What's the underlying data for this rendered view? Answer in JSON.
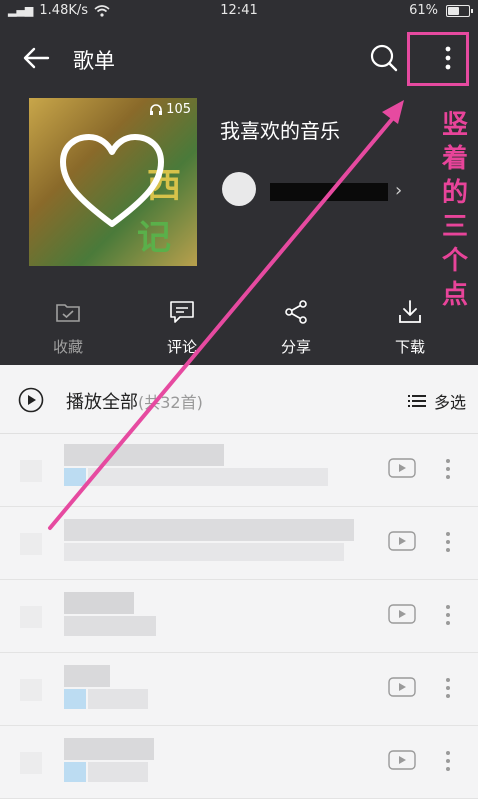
{
  "status_bar": {
    "net_speed": "1.48K/s",
    "time": "12:41",
    "battery": "61%",
    "battery_level": 0.61
  },
  "topbar": {
    "title": "歌单",
    "back_icon": "back-arrow-icon",
    "search_icon": "search-icon",
    "more_icon": "vertical-dots-icon"
  },
  "playlist": {
    "name": "我喜欢的音乐",
    "play_count": "105",
    "cover_text_1": "西",
    "cover_text_2": "记"
  },
  "actions": [
    {
      "label": "收藏",
      "icon": "folder-check-icon"
    },
    {
      "label": "评论",
      "icon": "comment-icon"
    },
    {
      "label": "分享",
      "icon": "share-icon"
    },
    {
      "label": "下载",
      "icon": "download-icon"
    }
  ],
  "play_all": {
    "label": "播放全部",
    "count": "(共32首)",
    "multi_select": "多选"
  },
  "annotation": {
    "text": "竖着的三个点",
    "color": "#e8449a"
  },
  "colors": {
    "header_bg": "#2f2f33",
    "list_bg": "#f4f4f5",
    "accent": "#e64aa0"
  }
}
